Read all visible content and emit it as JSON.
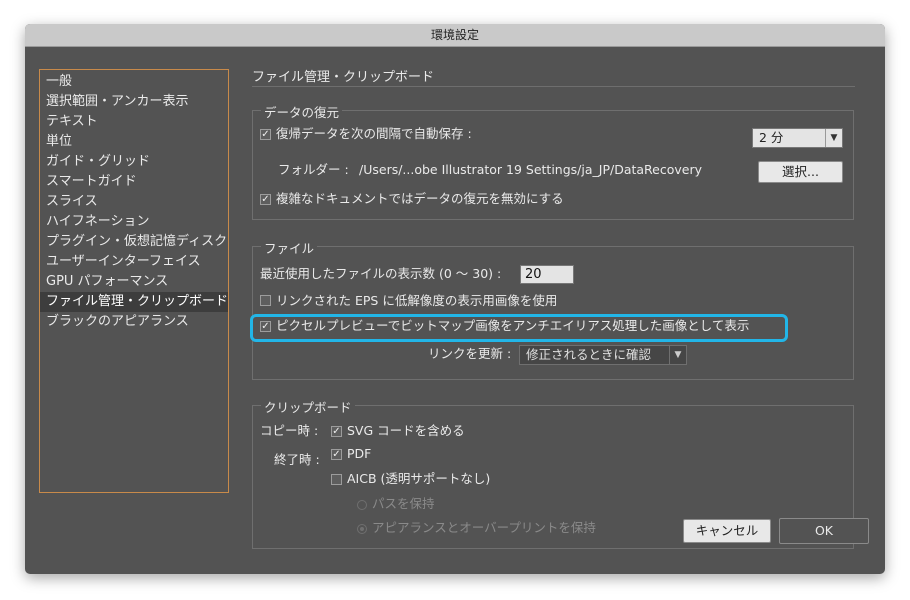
{
  "window": {
    "title": "環境設定"
  },
  "sidebar": {
    "items": [
      "一般",
      "選択範囲・アンカー表示",
      "テキスト",
      "単位",
      "ガイド・グリッド",
      "スマートガイド",
      "スライス",
      "ハイフネーション",
      "プラグイン・仮想記憶ディスク",
      "ユーザーインターフェイス",
      "GPU パフォーマンス",
      "ファイル管理・クリップボード",
      "ブラックのアピアランス"
    ],
    "selected_index": 11
  },
  "page": {
    "title": "ファイル管理・クリップボード"
  },
  "data_recovery": {
    "group_label": "データの復元",
    "autosave_label": "復帰データを次の間隔で自動保存 :",
    "autosave_checked": true,
    "interval_value": "2 分",
    "folder_label": "フォルダー :",
    "folder_path": "/Users/...obe Illustrator 19 Settings/ja_JP/DataRecovery",
    "choose_button": "選択...",
    "disable_complex_label": "複雑なドキュメントではデータの復元を無効にする",
    "disable_complex_checked": true
  },
  "files": {
    "group_label": "ファイル",
    "recent_files_label": "最近使用したファイルの表示数 (0 〜 30) :",
    "recent_files_value": "20",
    "low_res_label": "リンクされた EPS に低解像度の表示用画像を使用",
    "low_res_checked": false,
    "antialias_label": "ピクセルプレビューでビットマップ画像をアンチエイリアス処理した画像として表示",
    "antialias_checked": true,
    "update_links_label": "リンクを更新 :",
    "update_links_value": "修正されるときに確認"
  },
  "clipboard": {
    "group_label": "クリップボード",
    "copy_label": "コピー時 :",
    "svg_label": "SVG コードを含める",
    "svg_checked": true,
    "quit_label": "終了時 :",
    "pdf_label": "PDF",
    "pdf_checked": true,
    "aicb_label": "AICB (透明サポートなし)",
    "aicb_checked": false,
    "preserve_paths_label": "パスを保持",
    "preserve_appearance_label": "アピアランスとオーバープリントを保持"
  },
  "buttons": {
    "cancel": "キャンセル",
    "ok": "OK"
  },
  "colors": {
    "highlight": "#22b6e8",
    "selection_border": "#c88a4a",
    "panel": "#535353"
  },
  "icons": {
    "checkbox": "check-mark",
    "dropdown": "triangle-down"
  }
}
